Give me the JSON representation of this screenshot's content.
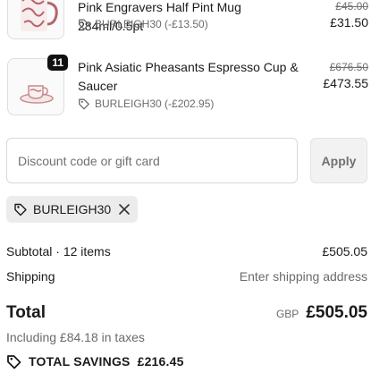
{
  "items": [
    {
      "title": "Pink Engravers Half Pint Mug 284ml/0.5pt",
      "discount": "BURLEIGH30 (-£13.50)",
      "original_price": "£45.00",
      "final_price": "£31.50"
    },
    {
      "quantity": "11",
      "title": "Pink Asiatic Pheasants Espresso Cup & Saucer",
      "discount": "BURLEIGH30 (-£202.95)",
      "original_price": "£676.50",
      "final_price": "£473.55"
    }
  ],
  "discount": {
    "placeholder": "Discount code or gift card",
    "apply_label": "Apply",
    "applied_code": "BURLEIGH30"
  },
  "summary": {
    "subtotal_label": "Subtotal · 12 items",
    "subtotal_value": "£505.05",
    "shipping_label": "Shipping",
    "shipping_value": "Enter shipping address",
    "total_label": "Total",
    "currency": "GBP",
    "total_value": "£505.05",
    "taxes_note": "Including £84.18 in taxes",
    "savings_label": "TOTAL SAVINGS",
    "savings_value": "£216.45"
  },
  "icons": {
    "tag": "tag-icon",
    "close": "close-icon",
    "savings": "savings-tag-icon"
  },
  "colors": {
    "accent_pink": "#c98a8f",
    "badge": "#111111",
    "chip_bg": "#ececec"
  }
}
